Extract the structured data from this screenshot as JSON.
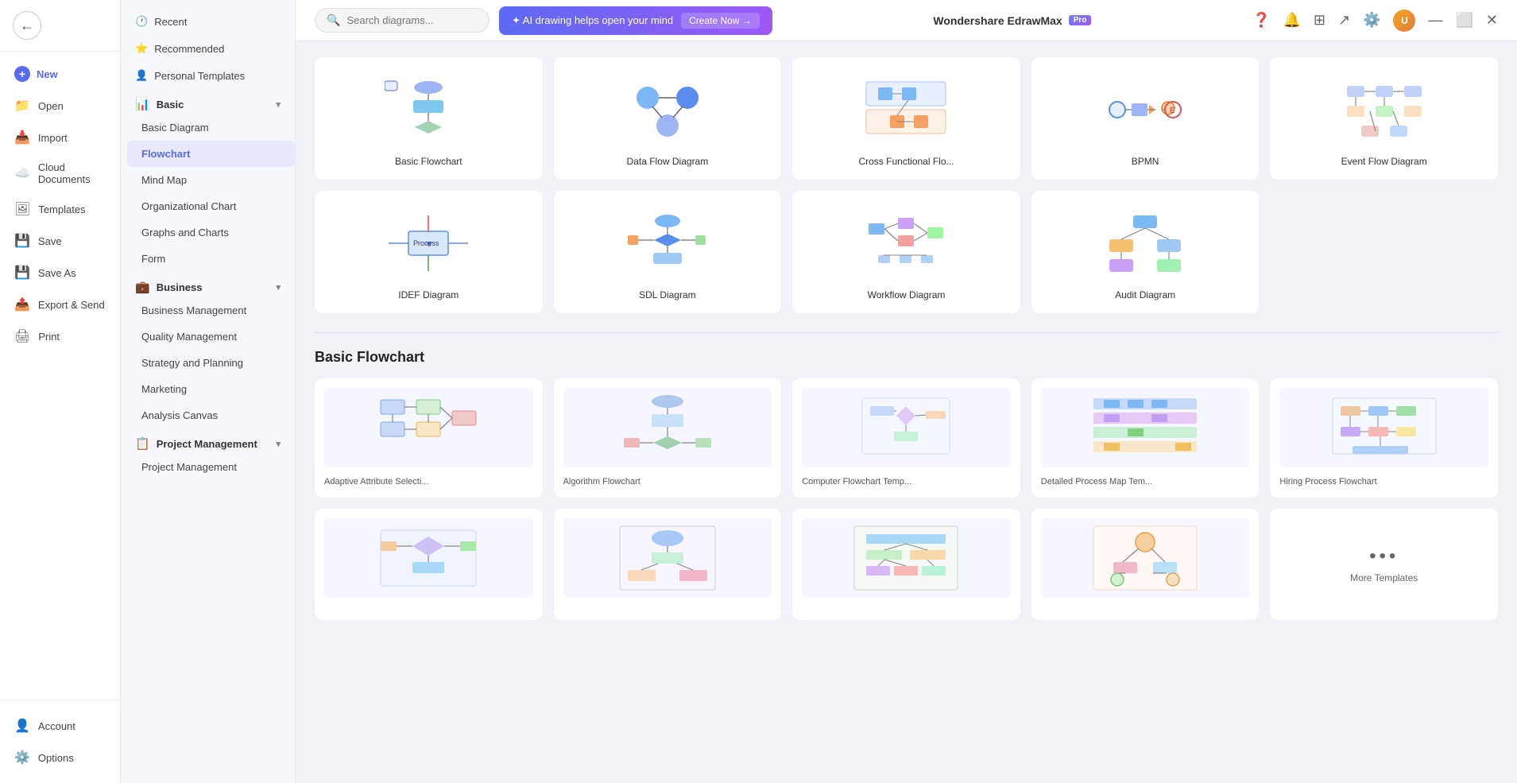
{
  "app": {
    "title": "Wondershare EdrawMax",
    "pro_badge": "Pro"
  },
  "topbar": {
    "search_placeholder": "Search diagrams...",
    "ai_banner_text": "✦ AI drawing helps open your mind",
    "create_now_label": "Create Now →"
  },
  "sidebar_left": {
    "back_icon": "←",
    "items": [
      {
        "id": "new",
        "label": "New",
        "icon": "📄",
        "has_plus": true
      },
      {
        "id": "open",
        "label": "Open",
        "icon": "📁"
      },
      {
        "id": "import",
        "label": "Import",
        "icon": "📥"
      },
      {
        "id": "cloud",
        "label": "Cloud Documents",
        "icon": "☁️"
      },
      {
        "id": "templates",
        "label": "Templates",
        "icon": "🖼"
      },
      {
        "id": "save",
        "label": "Save",
        "icon": "💾"
      },
      {
        "id": "saveas",
        "label": "Save As",
        "icon": "💾"
      },
      {
        "id": "export",
        "label": "Export & Send",
        "icon": "📤"
      },
      {
        "id": "print",
        "label": "Print",
        "icon": "🖨"
      }
    ],
    "bottom_items": [
      {
        "id": "account",
        "label": "Account",
        "icon": "👤"
      },
      {
        "id": "options",
        "label": "Options",
        "icon": "⚙️"
      }
    ]
  },
  "nav_panel": {
    "sections": [
      {
        "id": "recent",
        "label": "Recent",
        "icon": "🕐",
        "type": "item"
      },
      {
        "id": "recommended",
        "label": "Recommended",
        "icon": "⭐",
        "type": "item"
      },
      {
        "id": "personal",
        "label": "Personal Templates",
        "icon": "👤",
        "type": "item"
      },
      {
        "id": "basic",
        "label": "Basic",
        "icon": "📊",
        "type": "section",
        "expanded": true,
        "children": [
          {
            "id": "basic-diagram",
            "label": "Basic Diagram"
          },
          {
            "id": "flowchart",
            "label": "Flowchart",
            "active": true
          },
          {
            "id": "mind-map",
            "label": "Mind Map"
          },
          {
            "id": "org-chart",
            "label": "Organizational Chart"
          },
          {
            "id": "graphs",
            "label": "Graphs and Charts"
          },
          {
            "id": "form",
            "label": "Form"
          }
        ]
      },
      {
        "id": "business",
        "label": "Business",
        "icon": "💼",
        "type": "section",
        "expanded": true,
        "children": [
          {
            "id": "biz-mgmt",
            "label": "Business Management"
          },
          {
            "id": "quality-mgmt",
            "label": "Quality Management"
          },
          {
            "id": "strategy",
            "label": "Strategy and Planning"
          },
          {
            "id": "marketing",
            "label": "Marketing"
          },
          {
            "id": "analysis",
            "label": "Analysis Canvas"
          }
        ]
      },
      {
        "id": "project",
        "label": "Project Management",
        "icon": "📋",
        "type": "section",
        "expanded": true,
        "children": [
          {
            "id": "proj-mgmt",
            "label": "Project Management"
          }
        ]
      }
    ]
  },
  "diagram_types": [
    {
      "id": "basic-flowchart",
      "label": "Basic Flowchart",
      "has_ai": true
    },
    {
      "id": "data-flow",
      "label": "Data Flow Diagram",
      "has_ai": false
    },
    {
      "id": "cross-functional",
      "label": "Cross Functional Flo...",
      "has_ai": false
    },
    {
      "id": "bpmn",
      "label": "BPMN",
      "has_ai": false
    },
    {
      "id": "event-flow",
      "label": "Event Flow Diagram",
      "has_ai": false
    },
    {
      "id": "idef",
      "label": "IDEF Diagram",
      "has_ai": false
    },
    {
      "id": "sdl",
      "label": "SDL Diagram",
      "has_ai": false
    },
    {
      "id": "workflow",
      "label": "Workflow Diagram",
      "has_ai": false
    },
    {
      "id": "audit",
      "label": "Audit Diagram",
      "has_ai": false
    }
  ],
  "section_title": "Basic Flowchart",
  "templates": [
    {
      "id": "adaptive",
      "label": "Adaptive Attribute Selecti..."
    },
    {
      "id": "algorithm",
      "label": "Algorithm Flowchart"
    },
    {
      "id": "computer",
      "label": "Computer Flowchart Temp..."
    },
    {
      "id": "detailed",
      "label": "Detailed Process Map Tem..."
    },
    {
      "id": "hiring",
      "label": "Hiring Process Flowchart"
    },
    {
      "id": "tpl6",
      "label": ""
    },
    {
      "id": "tpl7",
      "label": ""
    },
    {
      "id": "tpl8",
      "label": ""
    },
    {
      "id": "tpl9",
      "label": ""
    },
    {
      "id": "more",
      "label": "More Templates",
      "is_more": true
    }
  ],
  "icons": {
    "back": "←",
    "plus": "+",
    "search": "🔍",
    "chevron_down": "▾",
    "ai_star": "✦",
    "dots": "•••"
  }
}
